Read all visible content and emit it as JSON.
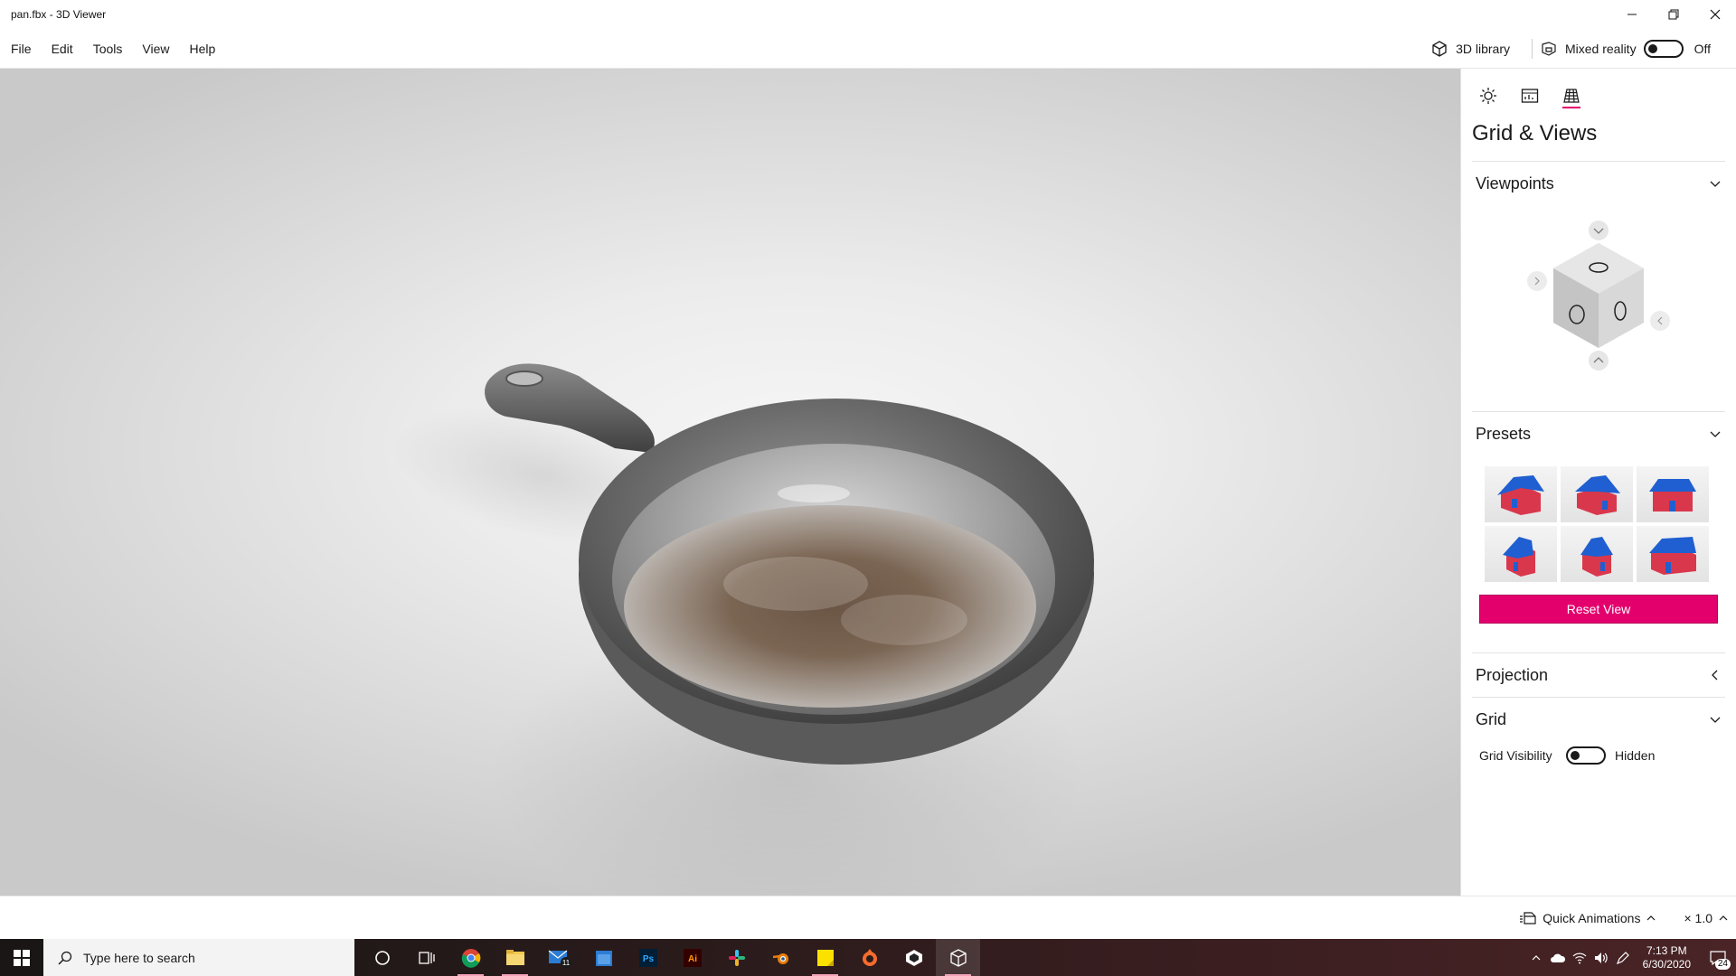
{
  "window": {
    "title": "pan.fbx - 3D Viewer"
  },
  "menu": {
    "items": [
      "File",
      "Edit",
      "Tools",
      "View",
      "Help"
    ],
    "library_label": "3D library",
    "mixed_reality_label": "Mixed reality",
    "mixed_reality_state": "Off"
  },
  "panel": {
    "tabs": [
      {
        "icon": "sun-icon",
        "active": false
      },
      {
        "icon": "stats-icon",
        "active": false
      },
      {
        "icon": "grid-icon",
        "active": true
      }
    ],
    "title": "Grid & Views",
    "viewpoints_label": "Viewpoints",
    "presets_label": "Presets",
    "reset_label": "Reset View",
    "projection_label": "Projection",
    "grid_label": "Grid",
    "grid_visibility_label": "Grid Visibility",
    "grid_visibility_state": "Hidden"
  },
  "status": {
    "animations_label": "Quick Animations",
    "zoom": "× 1.0"
  },
  "taskbar": {
    "search_placeholder": "Type here to search",
    "apps": [
      "cortana-icon",
      "task-view-icon",
      "chrome-icon",
      "file-explorer-icon",
      "mail-icon",
      "calendar-icon",
      "photoshop-icon",
      "illustrator-icon",
      "slack-icon",
      "blender-icon",
      "sticky-notes-icon",
      "origin-icon",
      "unity-icon",
      "3d-viewer-icon"
    ],
    "mail_badge": "11",
    "time": "7:13 PM",
    "date": "6/30/2020",
    "notifications": "24",
    "ps_label": "Ps",
    "ai_label": "Ai"
  },
  "colors": {
    "accent": "#e3006d"
  }
}
